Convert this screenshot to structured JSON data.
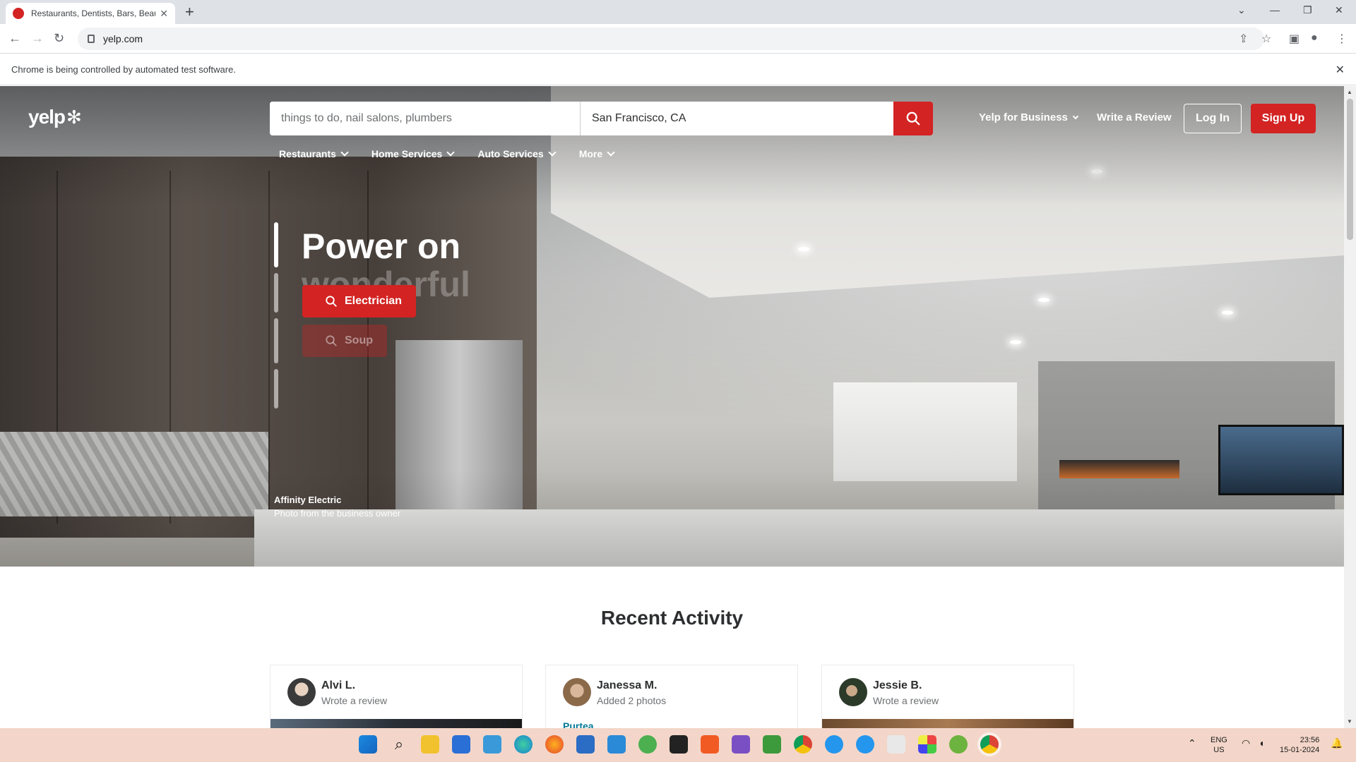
{
  "browser": {
    "tab_title": "Restaurants, Dentists, Bars, Beau",
    "url": "yelp.com",
    "infobar_text": "Chrome is being controlled by automated test software."
  },
  "header": {
    "logo_text": "yelp",
    "search_find_placeholder": "things to do, nail salons, plumbers",
    "search_near_placeholder": "San Francisco, CA",
    "yelp_for_business": "Yelp for Business",
    "write_review": "Write a Review",
    "login": "Log In",
    "signup": "Sign Up",
    "brand_color": "#d32323"
  },
  "categories": [
    {
      "label": "Restaurants"
    },
    {
      "label": "Home Services"
    },
    {
      "label": "Auto Services"
    },
    {
      "label": "More"
    }
  ],
  "hero": {
    "headline": "Power on",
    "headline_ghost": "wonderful",
    "cta_primary": "Electrician",
    "cta_secondary": "Soup",
    "credit_name": "Affinity Electric",
    "credit_sub": "Photo from the business owner"
  },
  "recent_activity": {
    "title": "Recent Activity",
    "cards": [
      {
        "name": "Alvi L.",
        "action": "Wrote a review",
        "link": ""
      },
      {
        "name": "Janessa M.",
        "action": "Added 2 photos",
        "link": "Purtea"
      },
      {
        "name": "Jessie B.",
        "action": "Wrote a review",
        "link": ""
      }
    ]
  },
  "taskbar": {
    "lang_top": "ENG",
    "lang_bottom": "US",
    "time": "23:56",
    "date": "15-01-2024"
  }
}
